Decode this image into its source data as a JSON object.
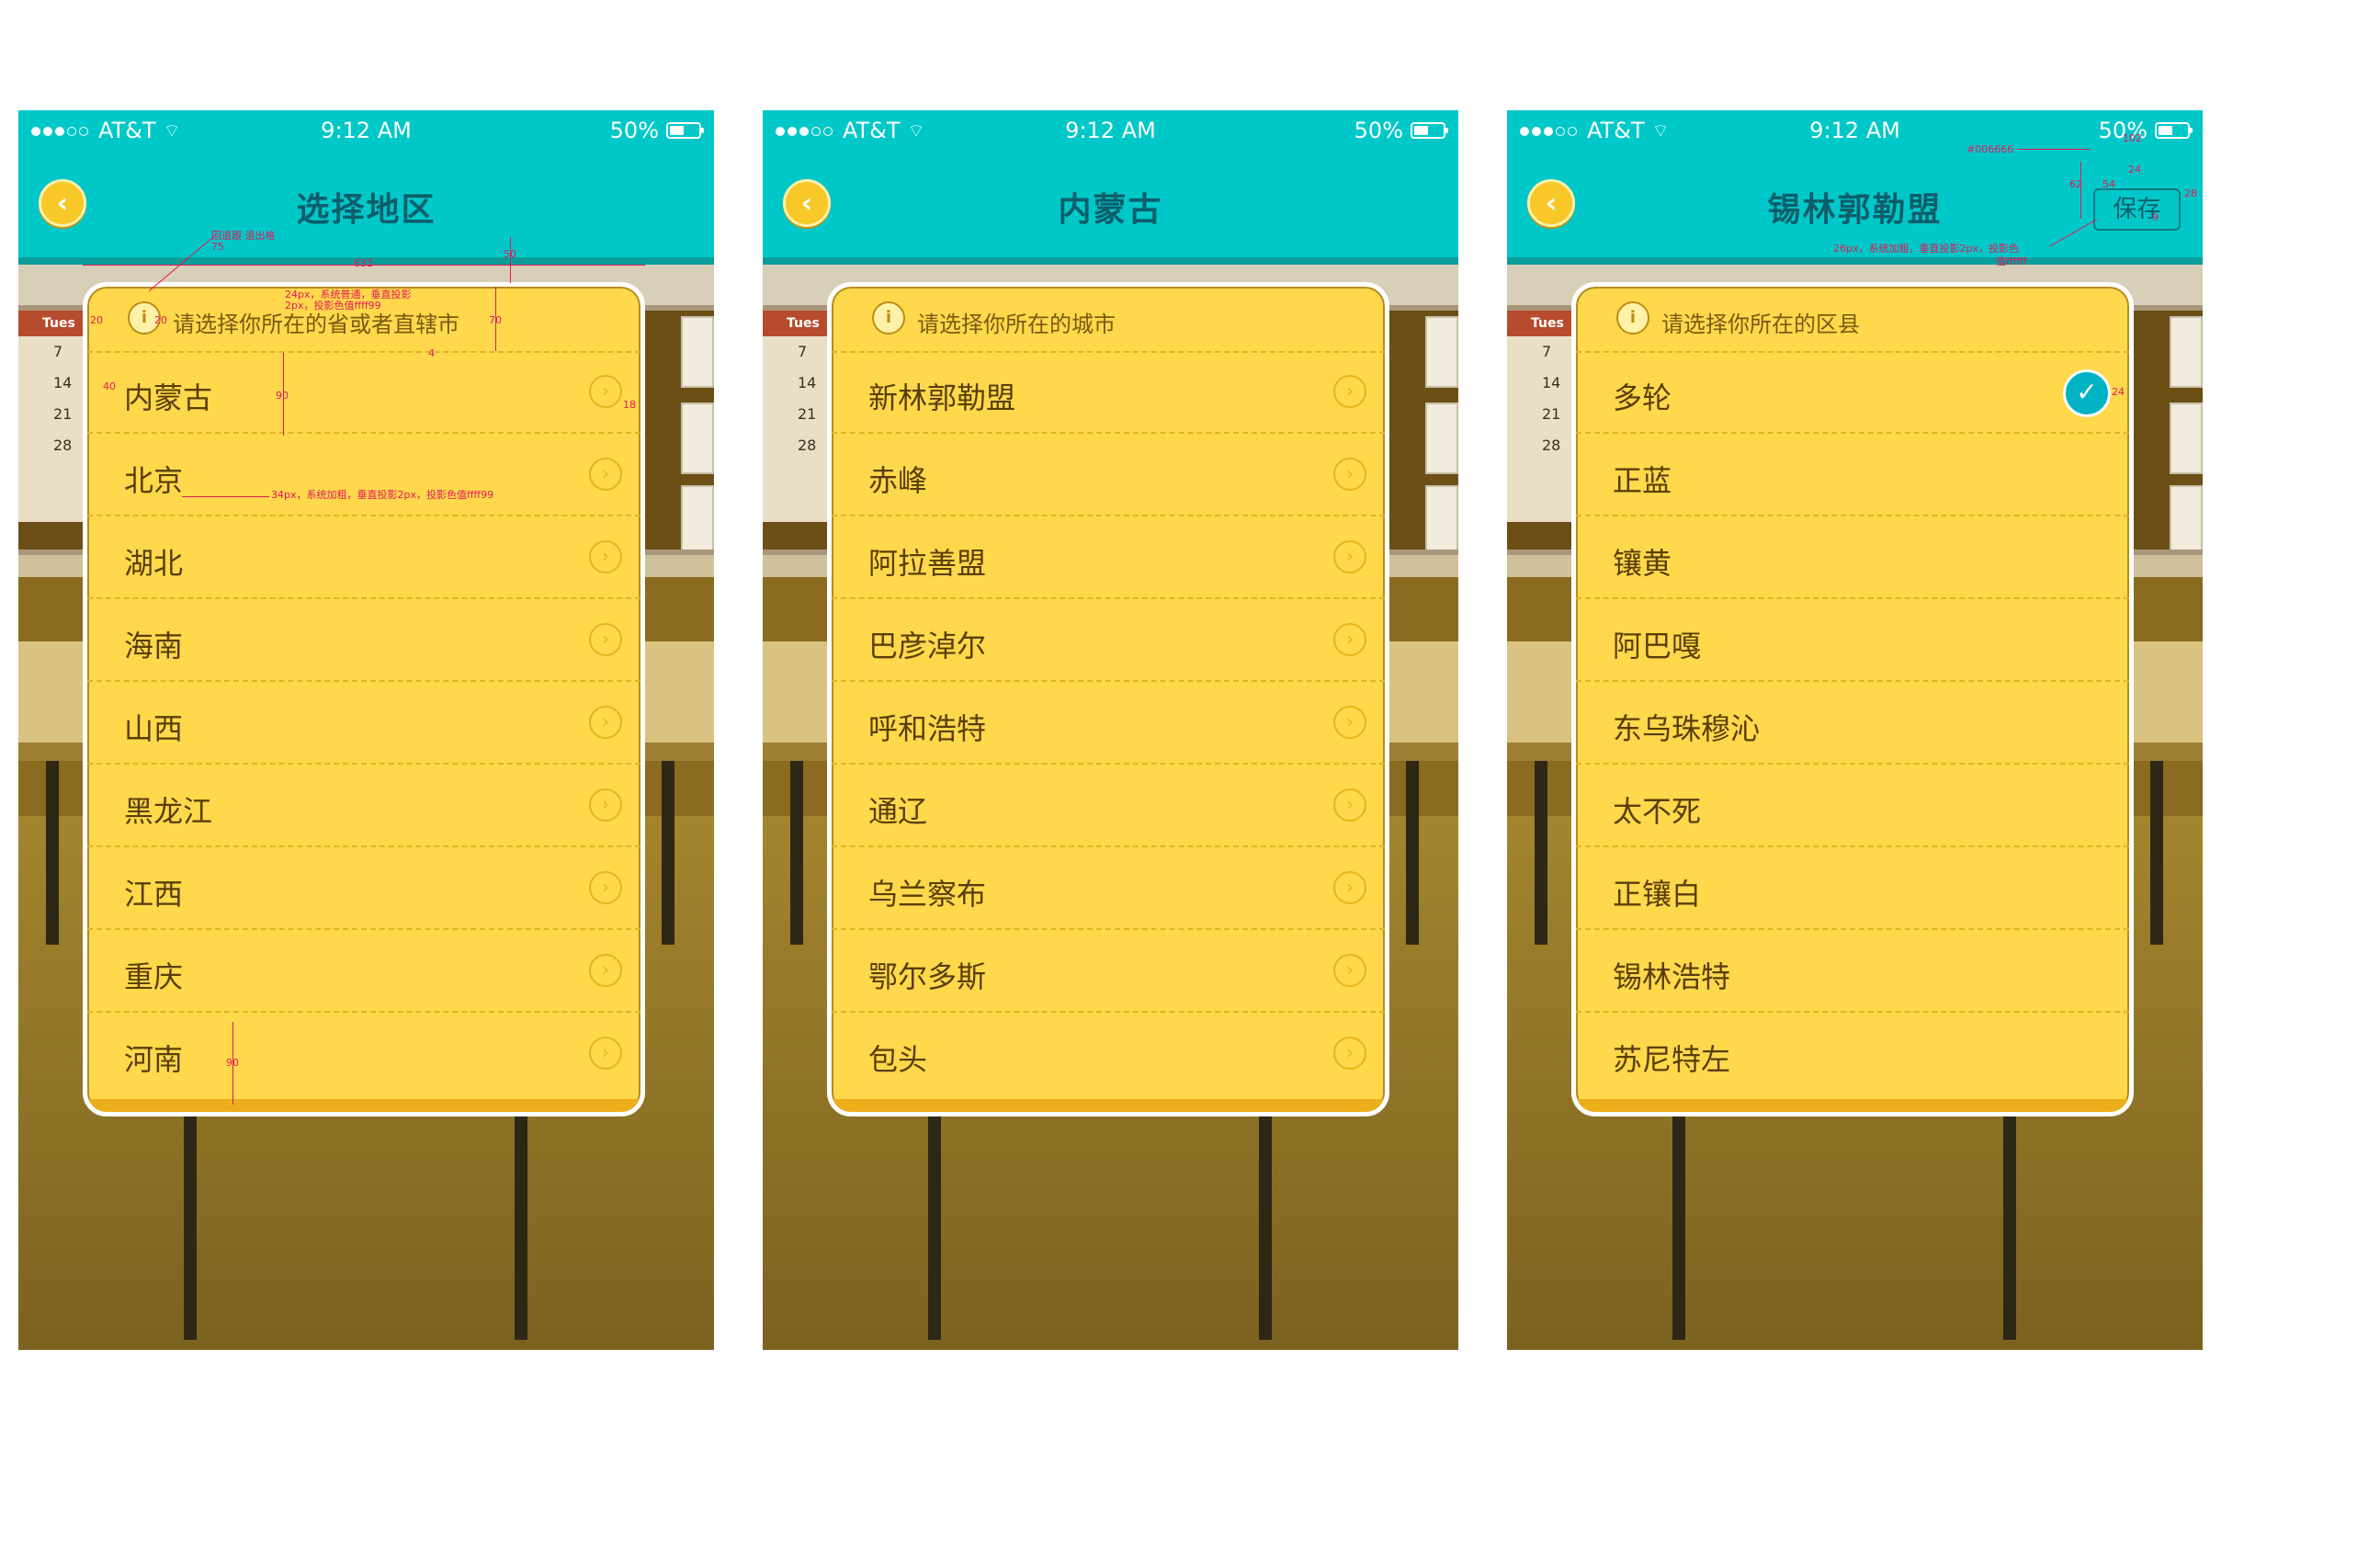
{
  "status_bar": {
    "carrier": "AT&T",
    "time": "9:12 AM",
    "battery": "50%"
  },
  "icons": {
    "back": "chevron-left-icon",
    "hint": "info-icon",
    "chevron": "chevron-right-icon",
    "check": "checkmark-icon",
    "wifi": "wifi-icon",
    "battery": "battery-icon"
  },
  "colors": {
    "navbar": "#00c8c8",
    "title": "#0c5e6a",
    "popup": "#ffd84c",
    "check": "#00b3c2",
    "annotation": "#e5195a"
  },
  "calendar": {
    "day": "Tues",
    "dates": [
      "7",
      "14",
      "21",
      "28"
    ]
  },
  "screens": [
    {
      "title": "选择地区",
      "hint": "请选择你所在的省或者直辖市",
      "items": [
        "内蒙古",
        "北京",
        "湖北",
        "海南",
        "山西",
        "黑龙江",
        "江西",
        "重庆",
        "河南"
      ]
    },
    {
      "title": "内蒙古",
      "hint": "请选择你所在的城市",
      "items": [
        "新林郭勒盟",
        "赤峰",
        "阿拉善盟",
        "巴彦淖尔",
        "呼和浩特",
        "通辽",
        "乌兰察布",
        "鄂尔多斯",
        "包头"
      ]
    },
    {
      "title": "锡林郭勒盟",
      "save": "保存",
      "hint": "请选择你所在的区县",
      "items": [
        "多轮",
        "正蓝",
        "镶黄",
        "阿巴嘎",
        "东乌珠穆沁",
        "太不死",
        "正镶白",
        "锡林浩特",
        "苏尼特左"
      ],
      "selected_index": 0
    }
  ],
  "annotations": {
    "a1": "回退跟 退出格",
    "a1b": "75",
    "a2": "632",
    "a3": "50",
    "a4": "24px，系统普通，垂直投影",
    "a4b": "2px，投影色值ffff99",
    "a5": "20",
    "a6": "20",
    "a7": "70",
    "a8": "4",
    "a9": "40",
    "a10": "90",
    "a11": "18",
    "a12": "34px，系统加粗，垂直投影2px，投影色值ffff99",
    "a13": "90",
    "b1": "#006666",
    "b2": "102",
    "b3": "24",
    "b4": "62",
    "b5": "54",
    "b6": "28",
    "b7": "9",
    "b8": "26px，系统加粗，垂直投影2px，投影色",
    "b8b": "值ffffff",
    "c1": "24"
  }
}
